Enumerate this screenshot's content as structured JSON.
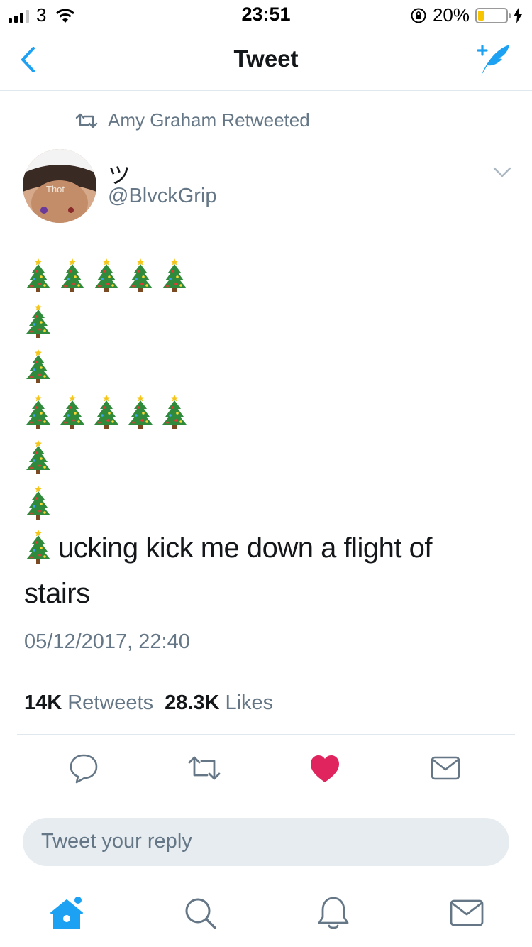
{
  "status_bar": {
    "carrier": "3",
    "time": "23:51",
    "battery_percent": "20%",
    "battery_level": 0.2
  },
  "nav": {
    "title": "Tweet",
    "back_icon": "chevron-left-icon",
    "compose_icon": "compose-tweet-icon"
  },
  "retweet_context": {
    "text": "Amy Graham Retweeted",
    "icon": "retweet-icon"
  },
  "author": {
    "display_name": "ツ",
    "handle": "@BlvckGrip",
    "avatar_text": "Thot"
  },
  "tweet": {
    "tree_rows": [
      5,
      1,
      1,
      5,
      1,
      1
    ],
    "line_text": "ucking kick me down a flight of",
    "line_text_2": "stairs",
    "timestamp": "05/12/2017, 22:40"
  },
  "stats": {
    "retweets_count": "14K",
    "retweets_label": "Retweets",
    "likes_count": "28.3K",
    "likes_label": "Likes"
  },
  "actions": [
    "reply-icon",
    "retweet-icon",
    "like-icon",
    "direct-message-icon"
  ],
  "colors": {
    "accent": "#1da1f2",
    "like": "#e0245e",
    "secondary_text": "#657786",
    "divider": "#e1e8ed",
    "reply_bg": "#e6ecf0"
  },
  "reply": {
    "placeholder": "Tweet your reply"
  },
  "tabs": [
    "home-icon",
    "search-icon",
    "notifications-icon",
    "messages-icon"
  ]
}
